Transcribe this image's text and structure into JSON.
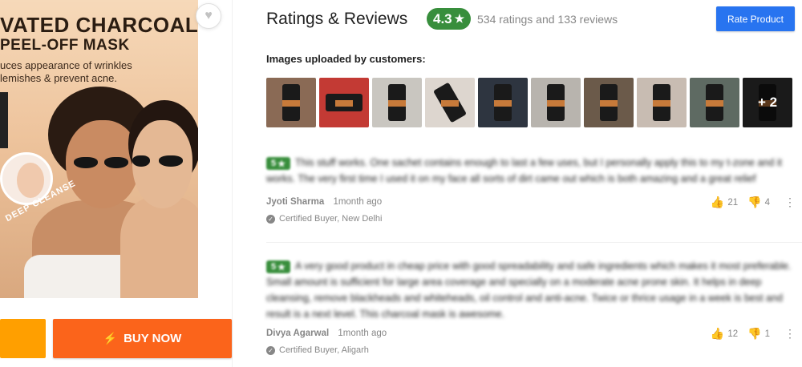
{
  "product": {
    "banner_title": "VATED CHARCOAL",
    "banner_subtitle": "PEEL-OFF MASK",
    "banner_line1": "uces appearance of wrinkles",
    "banner_line2": "lemishes & prevent acne.",
    "badge_text": "DEEP CLEANSE",
    "wishlist_icon": "heart-icon",
    "buy_now_label": "BUY NOW",
    "buy_icon": "bolt-icon"
  },
  "colors": {
    "rating_green": "#388e3c",
    "primary_blue": "#2874f0",
    "buy_orange": "#fb641b",
    "cart_yellow": "#ff9f00"
  },
  "ratings": {
    "title": "Ratings & Reviews",
    "score": "4.3",
    "star": "★",
    "count_text": "534 ratings and 133 reviews",
    "rate_button": "Rate Product",
    "images_label": "Images uploaded by customers:",
    "more_images": "+ 2"
  },
  "reviews": [
    {
      "stars": "5",
      "star": "★",
      "text": "This stuff works. One sachet contains enough to last a few uses, but I personally apply this to my t-zone and it works. The very first time I used it on my face all sorts of dirt came out which is both amazing and a great relief",
      "author": "Jyoti Sharma",
      "date": "1month ago",
      "certified": "Certified Buyer, New Delhi",
      "likes": "21",
      "dislikes": "4"
    },
    {
      "stars": "5",
      "star": "★",
      "text": "A very good product in cheap price with good spreadability and safe ingredients which makes it most preferable. Small amount is sufficient for large area coverage and specially on a moderate acne prone skin. It helps in deep cleansing, remove blackheads and whiteheads, oil control and anti-acne. Twice or thrice usage in a week is best and result is a next level. This charcoal mask is awesome.",
      "author": "Divya Agarwal",
      "date": "1month ago",
      "certified": "Certified Buyer, Aligarh",
      "likes": "12",
      "dislikes": "1"
    }
  ]
}
